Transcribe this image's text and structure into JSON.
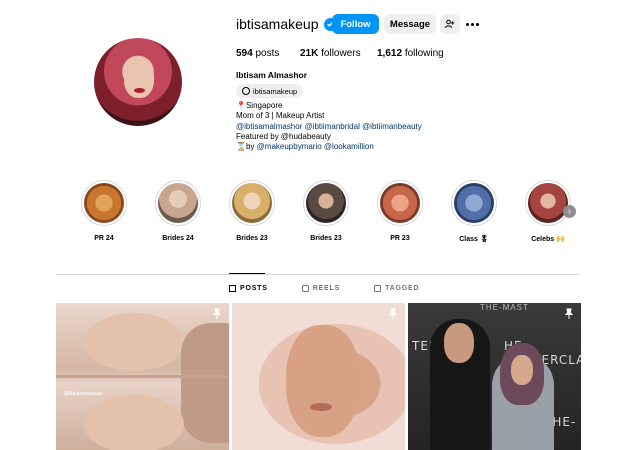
{
  "profile": {
    "username": "ibtisamakeup",
    "full_name": "Ibtisam Almashor",
    "threads_handle": "ibtisamakeup",
    "stats": {
      "posts_count": "594",
      "posts_label": "posts",
      "followers_count": "21K",
      "followers_label": "followers",
      "following_count": "1,612",
      "following_label": "following"
    },
    "bio": {
      "location": "Singapore",
      "line2": "Mom of 3 | Makeup Artist",
      "links": "@ibtisamalmashor @ibtiimanbridal @ibtiimanbeauty",
      "featured": "Featured by @hudabeauty",
      "by_prefix": "by",
      "by_links": "@makeupbymario @lookamillion"
    }
  },
  "actions": {
    "follow_label": "Follow",
    "message_label": "Message"
  },
  "highlights": [
    {
      "label": "PR 24",
      "color": "#c9772f"
    },
    {
      "label": "Brides 24",
      "color": "#c9a48e"
    },
    {
      "label": "Brides 23",
      "color": "#d9b06a"
    },
    {
      "label": "Brides 23",
      "color": "#5a4a44"
    },
    {
      "label": "PR 23",
      "color": "#c6674b"
    },
    {
      "label": "Class 🎖",
      "color": "#4f6fa6"
    },
    {
      "label": "Celebs 🙌",
      "color": "#a4453f"
    }
  ],
  "tabs": [
    {
      "label": "POSTS",
      "active": true
    },
    {
      "label": "REELS",
      "active": false
    },
    {
      "label": "TAGGED",
      "active": false
    }
  ],
  "posts": {
    "watermark": "@ibtisamakeup",
    "banner_text_1": "TERCLASS",
    "banner_text_2": "HE-MASTERCLA",
    "banner_text_3": "THE-",
    "banner_top": "THE-MAST"
  },
  "colors": {
    "accent": "#0095f6",
    "link": "#00376b"
  }
}
